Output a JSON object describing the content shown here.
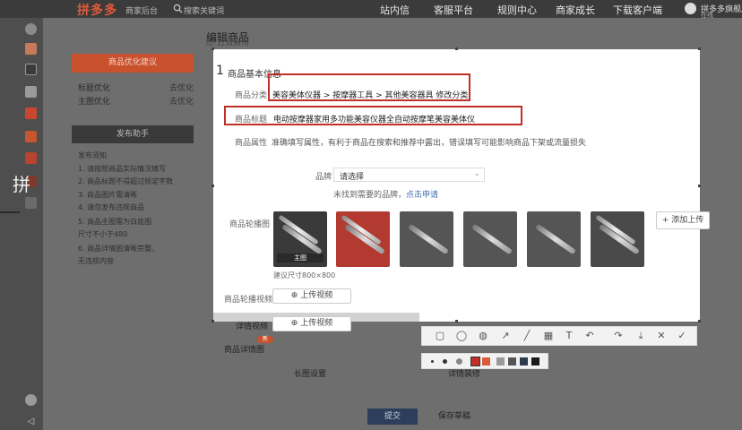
{
  "header": {
    "logo": "拼多多",
    "logo_sub": "商家后台",
    "search_placeholder": "搜索关键词",
    "nav": [
      "站内信",
      "客服平台",
      "规则中心",
      "商家成长",
      "下载客户端"
    ],
    "user_name": "拼多多旗舰店",
    "user_status": "在线"
  },
  "page": {
    "title": "编辑商品",
    "subtitle": "ID: 12345678"
  },
  "left_panel": {
    "optimize_button": "商品优化建议",
    "rows": [
      {
        "label": "标题优化",
        "action": "去优化"
      },
      {
        "label": "主图优化",
        "action": "去优化"
      }
    ],
    "help_button": "发布助手",
    "tips": [
      "发布须知",
      "1. 请按照商品实际情况填写",
      "2. 商品标题不得超过规定字数",
      "3. 商品图片需清晰",
      "4. 请勿发布违规商品",
      "5. 商品主图需为白底图",
      "尺寸不小于480",
      "6. 商品详情图清晰完整，",
      "无违规内容"
    ]
  },
  "side_char": "拼",
  "section": {
    "number": "1",
    "title": "商品基本信息"
  },
  "form": {
    "category_label": "商品分类",
    "category_value": "美容美体仪器 > 按摩器工具 > 其他美容器具  修改分类",
    "title_label": "商品标题",
    "title_value": "电动按摩器家用多功能美容仪器全自动按摩笔美容美体仪",
    "attr_label": "商品属性",
    "attr_desc": "准确填写属性，有利于商品在搜索和推荐中露出，错误填写可能影响商品下架或流量损失",
    "brand_label": "品牌",
    "brand_value": "请选择",
    "brand_link_prefix": "未找到需要的品牌，",
    "brand_link": "点击申请",
    "images_label": "商品轮播图",
    "thumb_caption": "主图",
    "images_hint": "建议尺寸800×800",
    "upload_image": "+ 添加上传",
    "video_label": "商品轮播视频",
    "video_button": "上传视频",
    "detail_video_label": "详情视频",
    "detail_video_button": "上传视频",
    "detail_label": "商品详情图",
    "detail_badge": "新",
    "other_label": "长图设置",
    "other_label2": "详情装修"
  },
  "footer": {
    "submit": "提交",
    "save_draft": "保存草稿"
  },
  "colors": {
    "accent": "#c9512d",
    "highlight": "#c03026",
    "toolbar_bg": "#f2f2f2"
  },
  "annotation_toolbar": {
    "tools": [
      "rectangle-icon",
      "ellipse-icon",
      "brush-icon",
      "arrow-icon",
      "line-icon",
      "mosaic-icon",
      "text-icon",
      "undo-icon",
      "redo-icon",
      "download-icon",
      "close-icon",
      "check-icon"
    ]
  }
}
